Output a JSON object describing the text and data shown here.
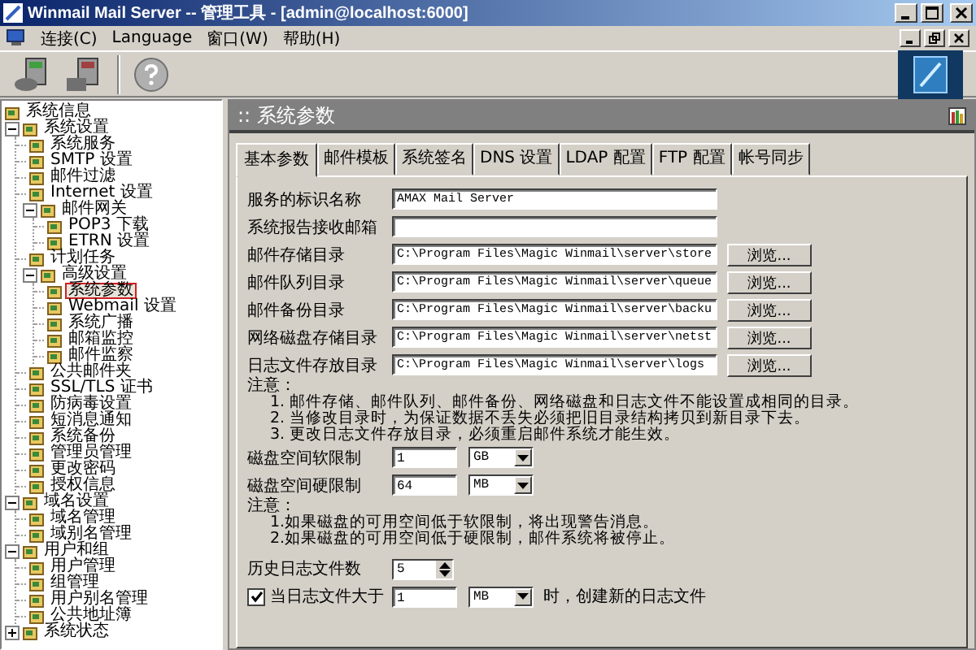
{
  "window": {
    "title": "Winmail Mail Server -- 管理工具 - [admin@localhost:6000]"
  },
  "menu": [
    "连接(C)",
    "Language",
    "窗口(W)",
    "帮助(H)"
  ],
  "tree": [
    {
      "label": "系统信息",
      "selected": false
    },
    {
      "label": "系统设置",
      "selected": false,
      "expanded": true,
      "children": [
        {
          "label": "系统服务",
          "selected": false
        },
        {
          "label": "SMTP 设置",
          "selected": false
        },
        {
          "label": "邮件过滤",
          "selected": false
        },
        {
          "label": "Internet 设置",
          "selected": false
        },
        {
          "label": "邮件网关",
          "selected": false,
          "expanded": true,
          "children": [
            {
              "label": "POP3 下载",
              "selected": false
            },
            {
              "label": "ETRN 设置",
              "selected": false
            }
          ]
        },
        {
          "label": "计划任务",
          "selected": false
        },
        {
          "label": "高级设置",
          "selected": false,
          "expanded": true,
          "children": [
            {
              "label": "系统参数",
              "selected": true
            },
            {
              "label": "Webmail 设置",
              "selected": false
            },
            {
              "label": "系统广播",
              "selected": false
            },
            {
              "label": "邮箱监控",
              "selected": false
            },
            {
              "label": "邮件监察",
              "selected": false
            }
          ]
        },
        {
          "label": "公共邮件夹",
          "selected": false
        },
        {
          "label": "SSL/TLS 证书",
          "selected": false
        },
        {
          "label": "防病毒设置",
          "selected": false
        },
        {
          "label": "短消息通知",
          "selected": false
        },
        {
          "label": "系统备份",
          "selected": false
        },
        {
          "label": "管理员管理",
          "selected": false
        },
        {
          "label": "更改密码",
          "selected": false
        },
        {
          "label": "授权信息",
          "selected": false
        }
      ]
    },
    {
      "label": "域名设置",
      "selected": false,
      "expanded": true,
      "children": [
        {
          "label": "域名管理",
          "selected": false
        },
        {
          "label": "域别名管理",
          "selected": false
        }
      ]
    },
    {
      "label": "用户和组",
      "selected": false,
      "expanded": true,
      "children": [
        {
          "label": "用户管理",
          "selected": false
        },
        {
          "label": "组管理",
          "selected": false
        },
        {
          "label": "用户别名管理",
          "selected": false
        },
        {
          "label": "公共地址簿",
          "selected": false
        }
      ]
    },
    {
      "label": "系统状态",
      "selected": false,
      "expanded": false
    }
  ],
  "panel": {
    "title": ":: 系统参数"
  },
  "tabs": [
    {
      "label": "基本参数",
      "selected": true
    },
    {
      "label": "邮件模板",
      "selected": false
    },
    {
      "label": "系统签名",
      "selected": false
    },
    {
      "label": "DNS 设置",
      "selected": false
    },
    {
      "label": "LDAP 配置",
      "selected": false
    },
    {
      "label": "FTP 配置",
      "selected": false
    },
    {
      "label": "帐号同步",
      "selected": false
    }
  ],
  "fields": [
    {
      "label": "服务的标识名称",
      "value": "AMAX Mail Server"
    },
    {
      "label": "系统报告接收邮箱"
    },
    {
      "label": "邮件存储目录",
      "value": "C:\\Program Files\\Magic Winmail\\server\\store",
      "button": "浏览..."
    },
    {
      "label": "邮件队列目录",
      "value": "C:\\Program Files\\Magic Winmail\\server\\queue",
      "button": "浏览..."
    },
    {
      "label": "邮件备份目录",
      "value": "C:\\Program Files\\Magic Winmail\\server\\backu",
      "button": "浏览..."
    },
    {
      "label": "网络磁盘存储目录",
      "value": "C:\\Program Files\\Magic Winmail\\server\\netst",
      "button": "浏览..."
    },
    {
      "label": "日志文件存放目录",
      "value": "C:\\Program Files\\Magic Winmail\\server\\logs",
      "button": "浏览..."
    }
  ],
  "notes_dirs": {
    "heading": "注意：",
    "items": [
      "1. 邮件存储、邮件队列、邮件备份、网络磁盘和日志文件不能设置成相同的目录。",
      "2. 当修改目录时，为保证数据不丢失必须把旧目录结构拷贝到新目录下去。",
      "3. 更改日志文件存放目录，必须重启邮件系统才能生效。"
    ]
  },
  "limits": [
    {
      "label": "磁盘空间软限制",
      "value": "1",
      "unit": "GB"
    },
    {
      "label": "磁盘空间硬限制",
      "value": "64",
      "unit": "MB"
    }
  ],
  "notes_limits": {
    "heading": "注意：",
    "items": [
      "1.如果磁盘的可用空间低于软限制，将出现警告消息。",
      "2.如果磁盘的可用空间低于硬限制，邮件系统将被停止。"
    ]
  },
  "history": {
    "label": "历史日志文件数",
    "value": "5"
  },
  "rotate": {
    "checked": true,
    "label": "当日志文件大于",
    "value": "1",
    "unit": "MB",
    "suffix": "时，创建新的日志文件"
  }
}
